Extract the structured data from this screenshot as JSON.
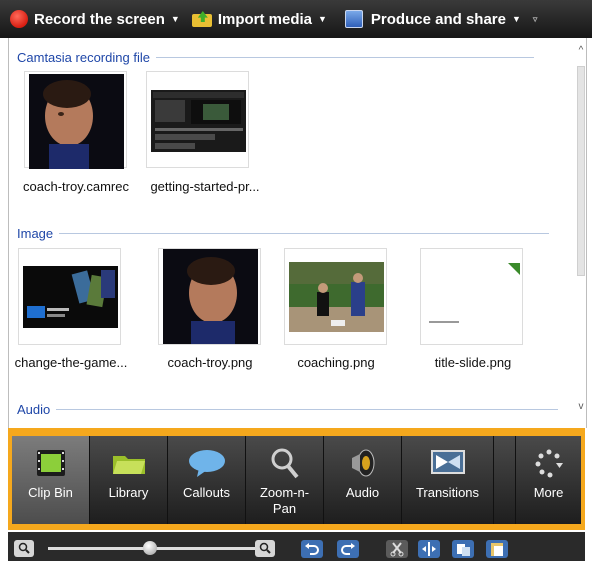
{
  "toolbar": {
    "record_label": "Record the screen",
    "import_label": "Import media",
    "produce_label": "Produce and share",
    "dropdown_glyph": "▼",
    "overflow_glyph": "▿"
  },
  "clip_bin": {
    "sections": [
      {
        "title": "Camtasia recording file",
        "items": [
          {
            "name": "coach-troy.camrec",
            "icon": "portrait-thumbnail"
          },
          {
            "name": "getting-started-pr...",
            "icon": "editor-screenshot-thumbnail"
          }
        ]
      },
      {
        "title": "Image",
        "items": [
          {
            "name": "change-the-game...",
            "icon": "phone-app-thumbnail"
          },
          {
            "name": "coach-troy.png",
            "icon": "portrait-thumbnail"
          },
          {
            "name": "coaching.png",
            "icon": "baseball-thumbnail"
          },
          {
            "name": "title-slide.png",
            "icon": "title-slide-thumbnail"
          }
        ]
      },
      {
        "title": "Audio",
        "items": []
      }
    ],
    "scroll_up": "^",
    "scroll_down": "v"
  },
  "tasks": {
    "items": [
      {
        "label": "Clip Bin",
        "icon": "film-strip-icon",
        "selected": true
      },
      {
        "label": "Library",
        "icon": "folder-icon"
      },
      {
        "label": "Callouts",
        "icon": "speech-bubble-icon"
      },
      {
        "label": "Zoom-n-\nPan",
        "icon": "magnifier-icon"
      },
      {
        "label": "Audio",
        "icon": "speaker-icon"
      },
      {
        "label": "Transitions",
        "icon": "transition-icon"
      },
      {
        "label": "More",
        "icon": "dots-icon"
      }
    ],
    "highlight_color": "#f5a81d"
  },
  "timeline_toolbar": {
    "zoom_out_glyph": "🔍",
    "zoom_in_glyph": "🔍",
    "zoom_level": 0.6,
    "buttons": [
      "undo-icon",
      "redo-icon",
      "cut-icon",
      "split-icon",
      "copy-icon",
      "paste-icon"
    ]
  }
}
